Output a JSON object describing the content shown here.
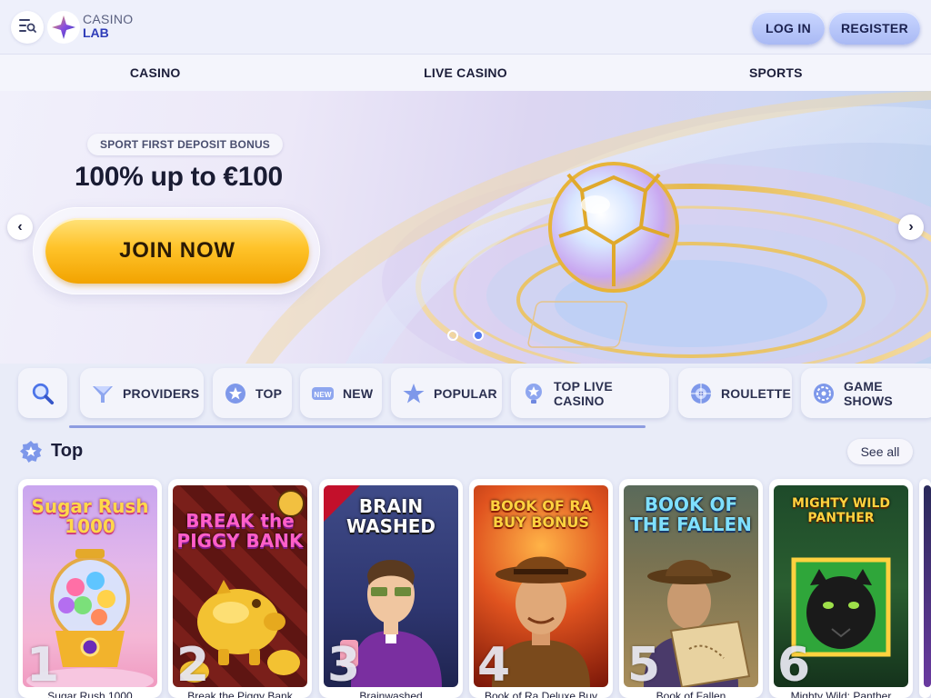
{
  "brand": {
    "line1": "CASINO",
    "line2": "LAB"
  },
  "header": {
    "login_label": "LOG IN",
    "register_label": "REGISTER"
  },
  "nav": [
    {
      "label": "CASINO"
    },
    {
      "label": "LIVE CASINO"
    },
    {
      "label": "SPORTS"
    }
  ],
  "banner": {
    "badge": "SPORT FIRST DEPOSIT BONUS",
    "headline": "100% up to €100",
    "cta": "JOIN NOW",
    "slides": 2,
    "active_slide": 2
  },
  "filters": [
    {
      "label": "PROVIDERS",
      "icon": "providers-icon"
    },
    {
      "label": "TOP",
      "icon": "star-badge-icon"
    },
    {
      "label": "NEW",
      "icon": "new-badge-icon"
    },
    {
      "label": "POPULAR",
      "icon": "star-icon"
    },
    {
      "label": "TOP LIVE CASINO",
      "icon": "live-star-icon"
    },
    {
      "label": "ROULETTE",
      "icon": "roulette-icon"
    },
    {
      "label": "GAME SHOWS",
      "icon": "game-show-icon"
    }
  ],
  "section": {
    "title": "Top",
    "see_all": "See all"
  },
  "games": [
    {
      "rank": "1",
      "name": "Sugar Rush 1000",
      "art_title": "Sugar Rush 1000"
    },
    {
      "rank": "2",
      "name": "Break the Piggy Bank",
      "art_title": "BREAK the PIGGY BANK"
    },
    {
      "rank": "3",
      "name": "Brainwashed",
      "art_title": "BRAIN WASHED"
    },
    {
      "rank": "4",
      "name": "Book of Ra Deluxe Buy",
      "art_title": "BOOK OF RA BUY BONUS"
    },
    {
      "rank": "5",
      "name": "Book of Fallen",
      "art_title": "BOOK OF THE FALLEN"
    },
    {
      "rank": "6",
      "name": "Mighty Wild: Panther",
      "art_title": "MIGHTY WILD PANTHER"
    }
  ],
  "colors": {
    "accent": "#4e78f0",
    "cta_gold": "#ffc32a",
    "pill_blue": "#b7c6fa"
  }
}
